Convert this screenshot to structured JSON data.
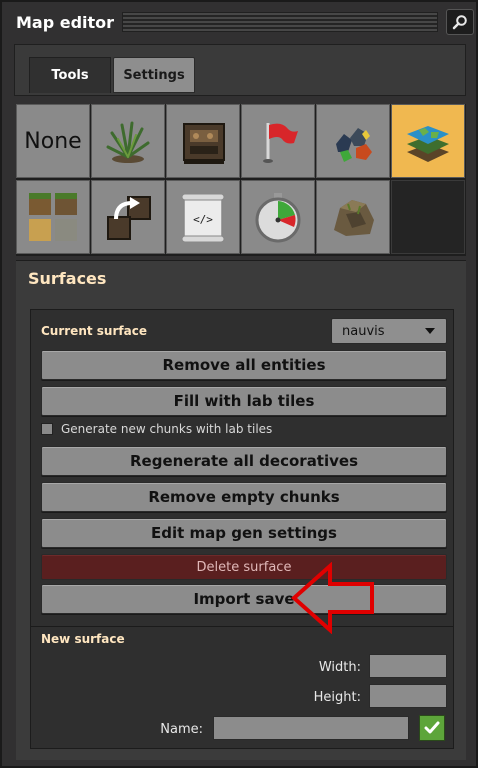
{
  "window": {
    "title": "Map editor"
  },
  "tabs": [
    {
      "label": "Tools",
      "active": true
    },
    {
      "label": "Settings",
      "active": false
    }
  ],
  "tools": [
    {
      "name": "none",
      "label": "None",
      "selected": false
    },
    {
      "name": "decoratives",
      "icon": "plant-icon",
      "selected": false
    },
    {
      "name": "entities",
      "icon": "assembler-icon",
      "selected": false
    },
    {
      "name": "tags",
      "icon": "flag-icon",
      "selected": false
    },
    {
      "name": "resources",
      "icon": "ore-icon",
      "selected": false
    },
    {
      "name": "surfaces",
      "icon": "map-layers-icon",
      "selected": true
    },
    {
      "name": "tiles",
      "icon": "tiles-icon",
      "selected": false
    },
    {
      "name": "clone",
      "icon": "clone-icon",
      "selected": false
    },
    {
      "name": "script",
      "icon": "script-icon",
      "label": "</>",
      "selected": false
    },
    {
      "name": "time",
      "icon": "stopwatch-icon",
      "selected": false
    },
    {
      "name": "cliffs",
      "icon": "rock-icon",
      "selected": false
    },
    {
      "name": "empty",
      "icon": "",
      "selected": false
    }
  ],
  "surfaces": {
    "title": "Surfaces",
    "current_surface_label": "Current surface",
    "current_surface_value": "nauvis",
    "buttons": {
      "remove_all_entities": "Remove all entities",
      "fill_lab_tiles": "Fill with lab tiles",
      "regenerate_decoratives": "Regenerate all decoratives",
      "remove_empty_chunks": "Remove empty chunks",
      "edit_map_gen": "Edit map gen settings",
      "delete_surface": "Delete surface",
      "import_save": "Import save"
    },
    "checkbox_label": "Generate new chunks with lab tiles",
    "checkbox_checked": false,
    "new_surface": {
      "title": "New surface",
      "width_label": "Width:",
      "height_label": "Height:",
      "name_label": "Name:",
      "width_value": "",
      "height_value": "",
      "name_value": ""
    }
  },
  "colors": {
    "accent_orange": "#f0b850",
    "danger": "#5a1f1f",
    "confirm": "#5da53a",
    "annotation_arrow": "#e00000"
  }
}
